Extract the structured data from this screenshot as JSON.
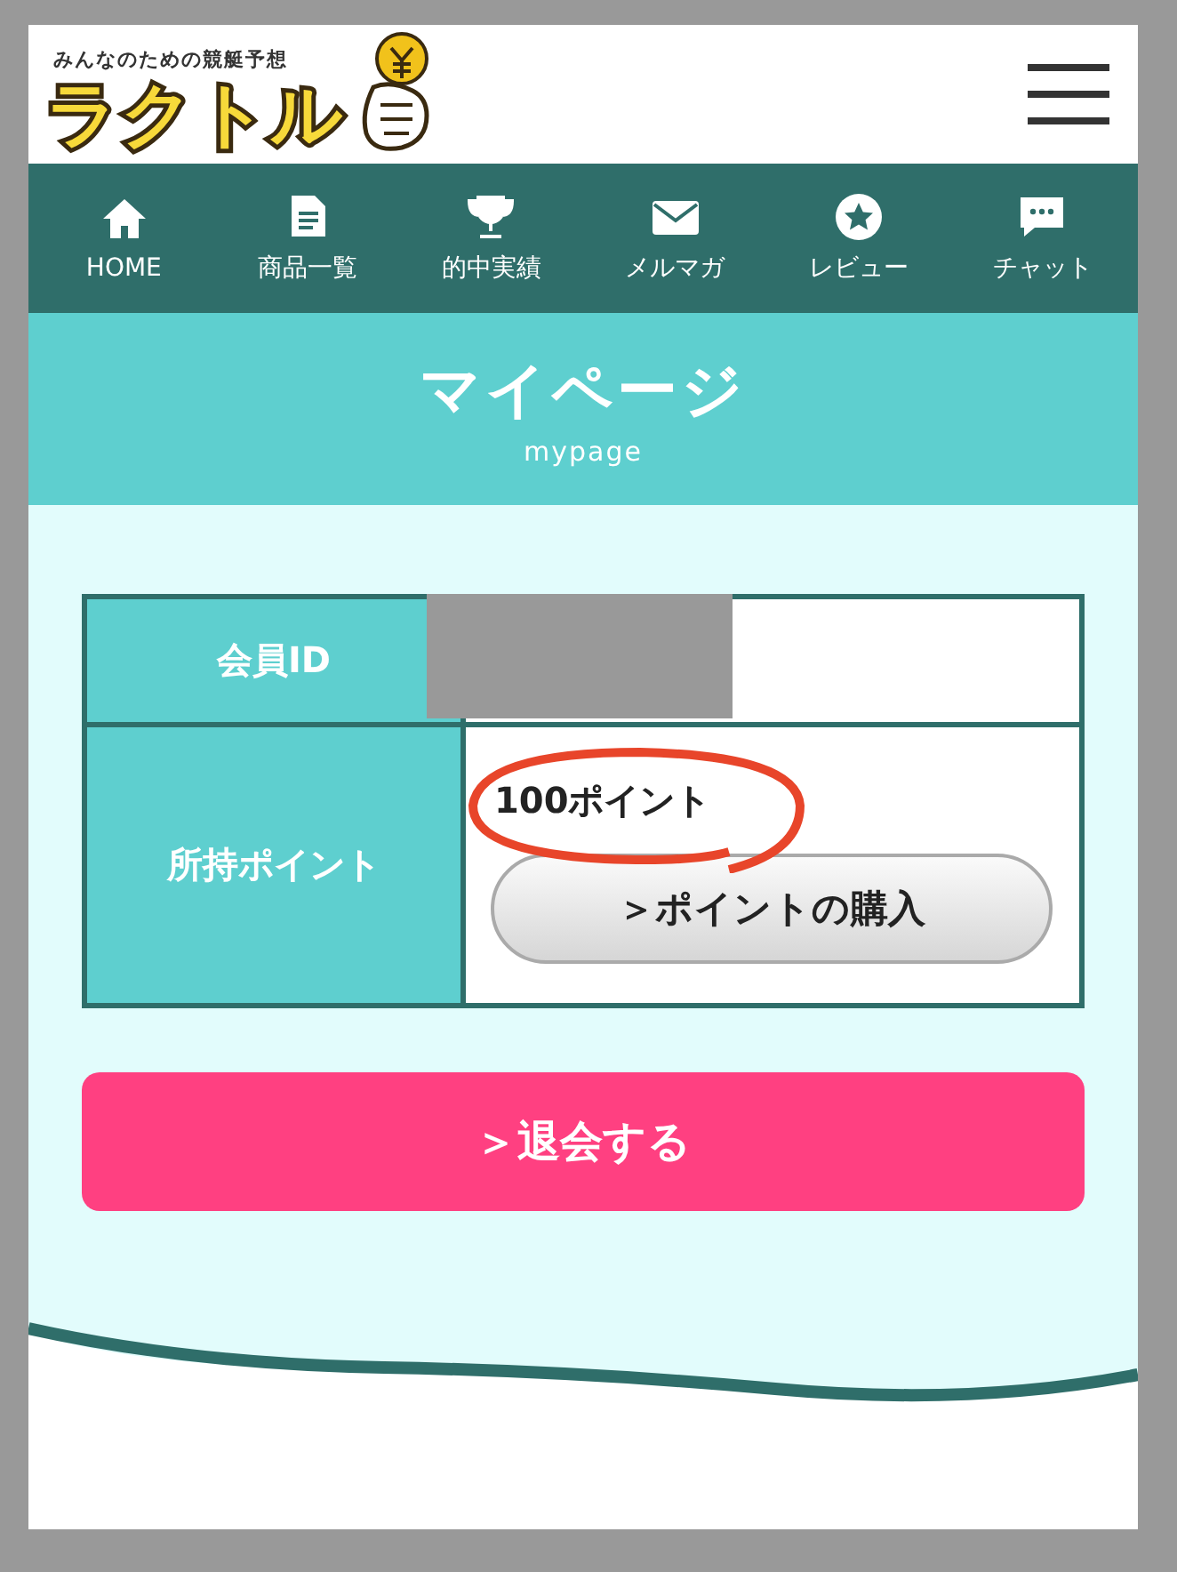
{
  "header": {
    "tagline": "みんなのための競艇予想",
    "logo": "ラクトル"
  },
  "nav": [
    {
      "label": "HOME"
    },
    {
      "label": "商品一覧"
    },
    {
      "label": "的中実績"
    },
    {
      "label": "メルマガ"
    },
    {
      "label": "レビュー"
    },
    {
      "label": "チャット"
    }
  ],
  "page_title": {
    "title": "マイページ",
    "subtitle": "mypage"
  },
  "member_table": {
    "rows": [
      {
        "label": "会員ID",
        "kind": "redacted"
      },
      {
        "label": "所持ポイント",
        "kind": "points",
        "value": "100ポイント",
        "button": "＞ポイントの購入"
      }
    ]
  },
  "withdraw_button": "＞退会する"
}
